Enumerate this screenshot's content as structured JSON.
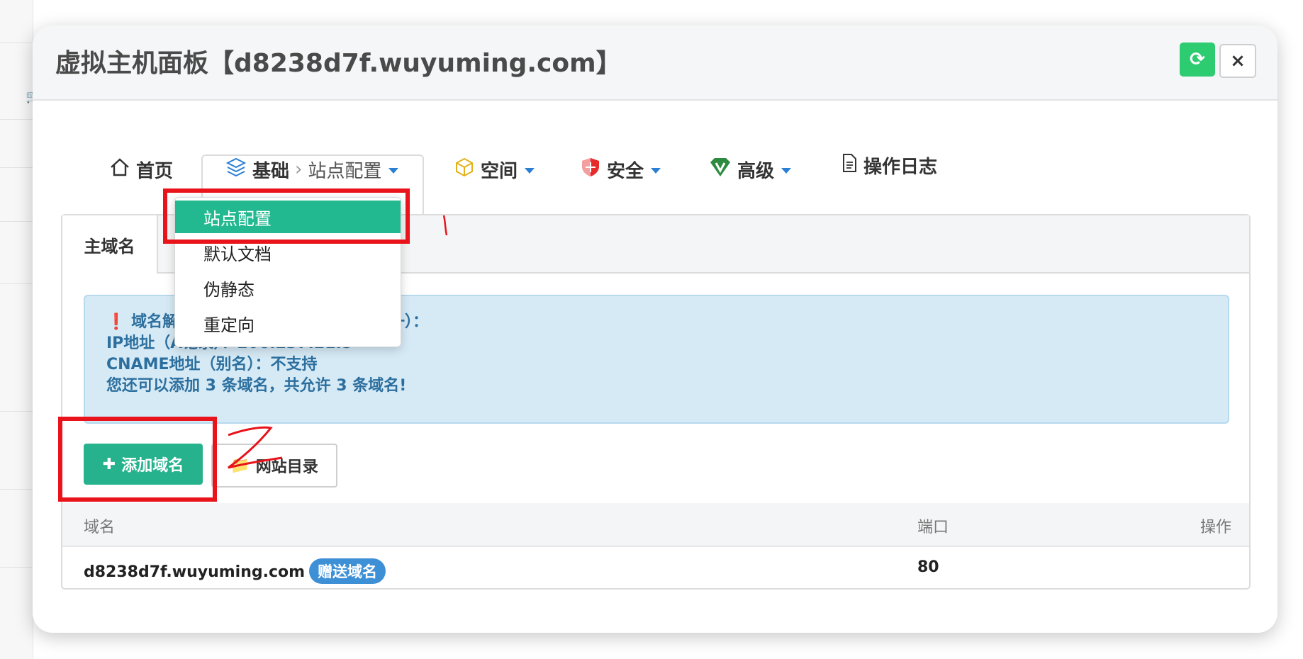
{
  "window": {
    "title": "虚拟主机面板【d8238d7f.wuyuming.com】"
  },
  "header_buttons": {
    "refresh_icon": "refresh-icon",
    "close_label": "×"
  },
  "nav": {
    "home": {
      "icon": "home-icon",
      "label": "首页"
    },
    "basic": {
      "icon": "layers-icon",
      "label": "基础",
      "separator": "›",
      "sub_label": "站点配置"
    },
    "space": {
      "icon": "cube-icon",
      "label": "空间"
    },
    "security": {
      "icon": "shield-icon",
      "label": "安全"
    },
    "advanced": {
      "icon": "vip-icon",
      "label": "高级"
    },
    "logs": {
      "icon": "document-icon",
      "label": "操作日志"
    }
  },
  "dropdown": {
    "items": [
      {
        "label": "站点配置",
        "active": true
      },
      {
        "label": "默认文档"
      },
      {
        "label": "伪静态"
      },
      {
        "label": "重定向"
      }
    ]
  },
  "panel": {
    "tab": "主域名",
    "alert": {
      "line1_visible": "域名解",
      "line1_tail": "二选一）：",
      "line2": "IP地址（A记录）：206.237.21.5",
      "line3": "CNAME地址（别名）：不支持",
      "line4": "您还可以添加 3 条域名，共允许 3 条域名!"
    },
    "add_button": "添加域名",
    "dir_button": "网站目录",
    "table": {
      "headers": [
        "域名",
        "端口",
        "操作"
      ],
      "rows": [
        {
          "domain": "d8238d7f.wuyuming.com",
          "badge": "赠送域名",
          "port": "80"
        }
      ]
    }
  },
  "colors": {
    "accent": "#26b28d",
    "annotation": "#e8131b",
    "alert_bg": "#d6eaf6",
    "refresh": "#2ecc71"
  }
}
